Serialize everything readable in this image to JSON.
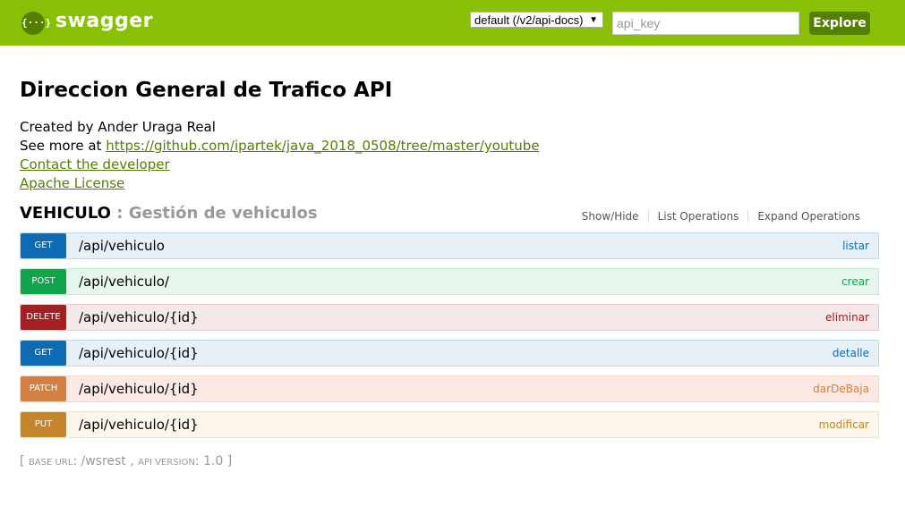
{
  "header": {
    "logo_glyph": "{···}",
    "logo_text": "swagger",
    "spec_select_value": "default (/v2/api-docs)",
    "api_key_placeholder": "api_key",
    "explore_label": "Explore",
    "brand_color": "#89bf04"
  },
  "info": {
    "title": "Direccion General de Trafico API",
    "created_by": "Created by Ander Uraga Real",
    "see_more_prefix": "See more at ",
    "see_more_link": "https://github.com/ipartek/java_2018_0508/tree/master/youtube",
    "contact_link": "Contact the developer",
    "license_link": "Apache License"
  },
  "resource": {
    "name": "VEHICULO",
    "separator": " : ",
    "description": "Gestión de vehiculos",
    "actions": [
      "Show/Hide",
      "List Operations",
      "Expand Operations"
    ]
  },
  "operations": [
    {
      "method": "GET",
      "path": "/api/vehiculo",
      "nickname": "listar"
    },
    {
      "method": "POST",
      "path": "/api/vehiculo/",
      "nickname": "crear"
    },
    {
      "method": "DELETE",
      "path": "/api/vehiculo/{id}",
      "nickname": "eliminar"
    },
    {
      "method": "GET",
      "path": "/api/vehiculo/{id}",
      "nickname": "detalle"
    },
    {
      "method": "PATCH",
      "path": "/api/vehiculo/{id}",
      "nickname": "darDeBaja"
    },
    {
      "method": "PUT",
      "path": "/api/vehiculo/{id}",
      "nickname": "modificar"
    }
  ],
  "footer": {
    "open_bracket": "[ ",
    "base_url_label": "base url",
    "base_url_value": ": /wsrest , ",
    "api_version_label": "api version",
    "api_version_value": ": 1.0 ]"
  }
}
